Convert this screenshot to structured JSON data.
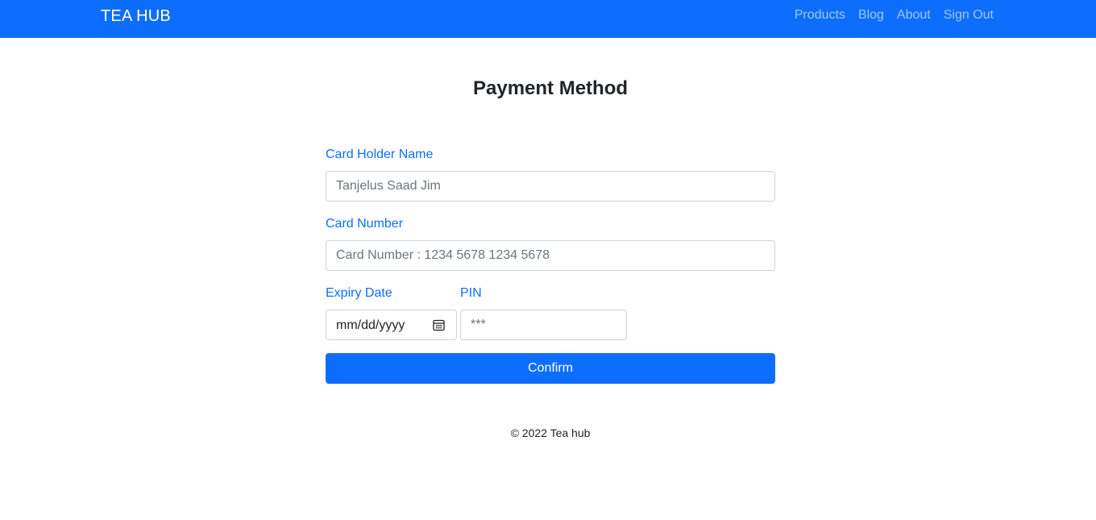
{
  "navbar": {
    "brand": "TEA HUB",
    "links": [
      "Products",
      "Blog",
      "About",
      "Sign Out"
    ]
  },
  "page": {
    "title": "Payment Method"
  },
  "form": {
    "card_holder_label": "Card Holder Name",
    "card_holder_placeholder": "Tanjelus Saad Jim",
    "card_number_label": "Card Number",
    "card_number_placeholder": "Card Number : 1234 5678 1234 5678",
    "expiry_label": "Expiry Date",
    "expiry_placeholder": "mm/dd/yyyy",
    "pin_label": "PIN",
    "pin_placeholder": "***",
    "confirm_label": "Confirm"
  },
  "footer": {
    "text": "© 2022 Tea hub"
  },
  "colors": {
    "primary": "#0d6efd",
    "border": "#ced4da",
    "text": "#212529",
    "placeholder": "#6c757d"
  },
  "icons": {
    "date_picker": "calendar-icon"
  }
}
